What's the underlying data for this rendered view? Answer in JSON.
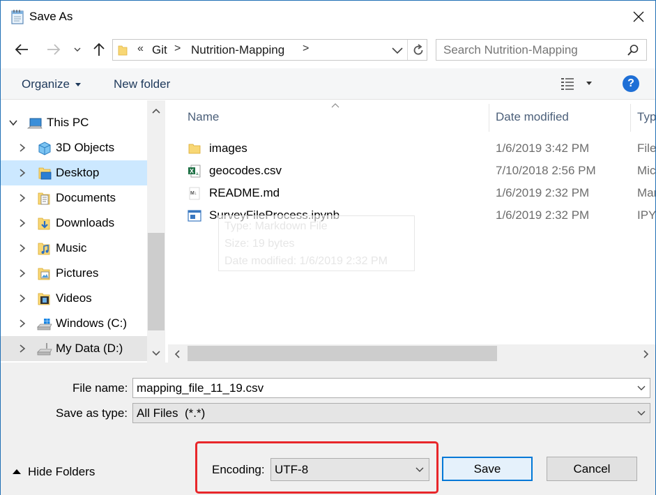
{
  "window": {
    "title": "Save As",
    "accent_color": "#0078d7",
    "title_icon": "notepad-icon",
    "close_icon": "close-icon"
  },
  "address_bar": {
    "overflow": "«",
    "segments": [
      "Git",
      "Nutrition-Mapping"
    ],
    "separator": ">"
  },
  "search": {
    "placeholder": "Search Nutrition-Mapping"
  },
  "toolbar": {
    "organize_label": "Organize",
    "new_folder_label": "New folder",
    "help_label": "?"
  },
  "nav_pane": {
    "root_label": "This PC",
    "items": [
      {
        "label": "3D Objects",
        "icon": "3d-objects-icon"
      },
      {
        "label": "Desktop",
        "icon": "desktop-icon"
      },
      {
        "label": "Documents",
        "icon": "documents-icon"
      },
      {
        "label": "Downloads",
        "icon": "downloads-icon"
      },
      {
        "label": "Music",
        "icon": "music-icon"
      },
      {
        "label": "Pictures",
        "icon": "pictures-icon"
      },
      {
        "label": "Videos",
        "icon": "videos-icon"
      },
      {
        "label": "Windows (C:)",
        "icon": "drive-c-icon"
      },
      {
        "label": "My Data (D:)",
        "icon": "drive-d-icon"
      }
    ]
  },
  "file_list": {
    "columns": [
      "Name",
      "Date modified",
      "Typ"
    ],
    "rows": [
      {
        "name": "images",
        "date": "1/6/2019 3:42 PM",
        "type": "File",
        "icon": "folder-icon"
      },
      {
        "name": "geocodes.csv",
        "date": "7/10/2018 2:56 PM",
        "type": "Mic",
        "icon": "excel-csv-icon"
      },
      {
        "name": "README.md",
        "date": "1/6/2019 2:32 PM",
        "type": "Mar",
        "icon": "markdown-file-icon"
      },
      {
        "name": "SurveyFileProcess.ipynb",
        "date": "1/6/2019 2:32 PM",
        "type": "IPY",
        "icon": "notebook-file-icon"
      }
    ],
    "tooltip": {
      "type": "Type: Markdown File",
      "size": "Size: 19 bytes",
      "date": "Date modified: 1/6/2019 2:32 PM"
    }
  },
  "form": {
    "file_name_label": "File name:",
    "file_name_value": "mapping_file_11_19.csv",
    "save_type_label": "Save as type:",
    "save_type_value": "All Files  (*.*)",
    "encoding_label": "Encoding:",
    "encoding_value": "UTF-8",
    "hide_folders_label": "Hide Folders",
    "save_label": "Save",
    "cancel_label": "Cancel",
    "highlight_color": "#e8262a"
  }
}
